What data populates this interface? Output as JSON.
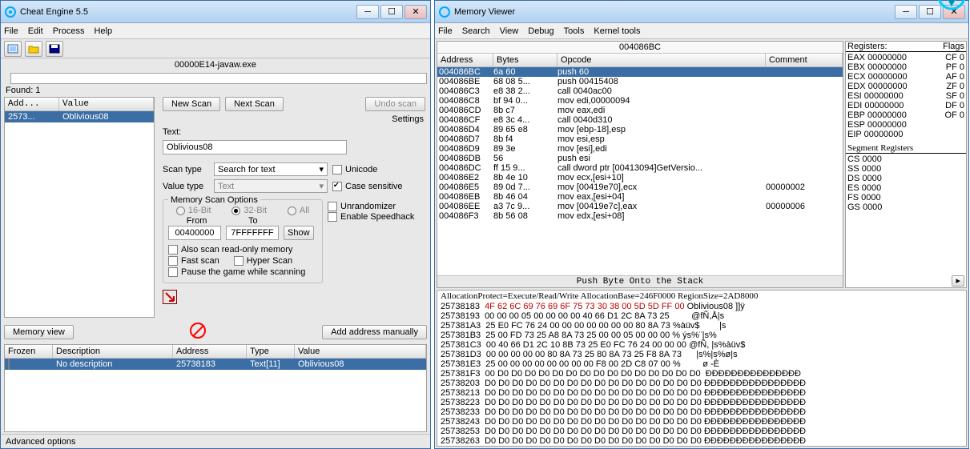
{
  "ce": {
    "title": "Cheat Engine 5.5",
    "menu": [
      "File",
      "Edit",
      "Process",
      "Help"
    ],
    "process": "00000E14-javaw.exe",
    "found": "Found: 1",
    "results_hdr": {
      "addr": "Add...",
      "val": "Value"
    },
    "results": {
      "addr": "2573...",
      "val": "Oblivious08"
    },
    "new_scan": "New Scan",
    "next_scan": "Next Scan",
    "undo_scan": "Undo scan",
    "settings": "Settings",
    "text_lbl": "Text:",
    "text_val": "Oblivious08",
    "scan_type_lbl": "Scan type",
    "scan_type_val": "Search for text",
    "value_type_lbl": "Value type",
    "value_type_val": "Text",
    "unicode": "Unicode",
    "case_sens": "Case sensitive",
    "mem_opts": "Memory Scan Options",
    "bit16": "16-Bit",
    "bit32": "32-Bit",
    "bitall": "All",
    "from": "From",
    "to": "To",
    "from_v": "00400000",
    "to_v": "7FFFFFFF",
    "show": "Show",
    "readonly": "Also scan read-only memory",
    "fastscan": "Fast scan",
    "hyperscan": "Hyper Scan",
    "pausegame": "Pause the game while scanning",
    "unrand": "Unrandomizer",
    "speedhack": "Enable Speedhack",
    "memview": "Memory view",
    "addman": "Add address manually",
    "tbl_hdr": {
      "fr": "Frozen",
      "de": "Description",
      "ad": "Address",
      "ty": "Type",
      "va": "Value"
    },
    "tbl_row": {
      "de": "No description",
      "ad": "25738183",
      "ty": "Text[11]",
      "va": "Oblivious08"
    },
    "adv": "Advanced options"
  },
  "mv": {
    "title": "Memory Viewer",
    "menu": [
      "File",
      "Search",
      "View",
      "Debug",
      "Tools",
      "Kernel tools"
    ],
    "curaddr": "004086BC",
    "cols": {
      "a": "Address",
      "b": "Bytes",
      "o": "Opcode",
      "c": "Comment"
    },
    "rows": [
      {
        "a": "004086BC",
        "b": "6a 60",
        "o": "push 60",
        "c": "",
        "sel": true
      },
      {
        "a": "004086BE",
        "b": "68 08 5...",
        "o": "push 00415408",
        "c": ""
      },
      {
        "a": "004086C3",
        "b": "e8 38 2...",
        "o": "call 0040ac00",
        "c": ""
      },
      {
        "a": "004086C8",
        "b": "bf 94 0...",
        "o": "mov edi,00000094",
        "c": ""
      },
      {
        "a": "004086CD",
        "b": "8b c7",
        "o": "mov eax,edi",
        "c": ""
      },
      {
        "a": "004086CF",
        "b": "e8 3c 4...",
        "o": "call 0040d310",
        "c": ""
      },
      {
        "a": "004086D4",
        "b": "89 65 e8",
        "o": "mov [ebp-18],esp",
        "c": ""
      },
      {
        "a": "004086D7",
        "b": "8b f4",
        "o": "mov esi,esp",
        "c": ""
      },
      {
        "a": "004086D9",
        "b": "89 3e",
        "o": "mov [esi],edi",
        "c": ""
      },
      {
        "a": "004086DB",
        "b": "56",
        "o": "push esi",
        "c": ""
      },
      {
        "a": "004086DC",
        "b": "ff 15 9...",
        "o": "call dword ptr [00413094]GetVersio...",
        "c": ""
      },
      {
        "a": "004086E2",
        "b": "8b 4e 10",
        "o": "mov ecx,[esi+10]",
        "c": ""
      },
      {
        "a": "004086E5",
        "b": "89 0d 7...",
        "o": "mov [00419e70],ecx",
        "c": "00000002"
      },
      {
        "a": "004086EB",
        "b": "8b 46 04",
        "o": "mov eax,[esi+04]",
        "c": ""
      },
      {
        "a": "004086EE",
        "b": "a3 7c 9...",
        "o": "mov [00419e7c],eax",
        "c": "00000006"
      },
      {
        "a": "004086F3",
        "b": "8b 56 08",
        "o": "mov edx,[esi+08]",
        "c": ""
      }
    ],
    "info": "Push Byte Onto the Stack",
    "regs_h": "Registers:",
    "flags_h": "Flags",
    "regs": [
      {
        "n": "EAX",
        "v": "00000000",
        "f": "CF 0"
      },
      {
        "n": "EBX",
        "v": "00000000",
        "f": "PF 0"
      },
      {
        "n": "ECX",
        "v": "00000000",
        "f": "AF 0"
      },
      {
        "n": "EDX",
        "v": "00000000",
        "f": "ZF 0"
      },
      {
        "n": "ESI",
        "v": "00000000",
        "f": "SF 0"
      },
      {
        "n": "EDI",
        "v": "00000000",
        "f": "DF 0"
      },
      {
        "n": "EBP",
        "v": "00000000",
        "f": "OF 0"
      },
      {
        "n": "ESP",
        "v": "00000000",
        "f": ""
      },
      {
        "n": "EIP",
        "v": "00000000",
        "f": ""
      }
    ],
    "seg_h": "Segment Registers",
    "segs": [
      "CS 0000",
      "SS 0000",
      "DS 0000",
      "ES 0000",
      "FS 0000",
      "GS 0000"
    ],
    "dump_hdr": "AllocationProtect=Execute/Read/Write AllocationBase=246F0000 RegionSize=2AD8000",
    "dump": [
      {
        "a": "25738183",
        "h": "4F 62 6C 69 76 69 6F 75 73 30 38 00 5D 5D FF 00",
        "t": "Oblivious08 ]]ÿ",
        "red": true
      },
      {
        "a": "25738193",
        "h": "00 00 00 05 00 00 00 00 40 66 D1 2C 8A 73 25",
        "t": "        @fÑ,Å|s"
      },
      {
        "a": "257381A3",
        "h": "25 E0 FC 76 24 00 00 00 00 00 00 00 80 8A 73",
        "t": "%àüv$        |s"
      },
      {
        "a": "257381B3",
        "h": "25 00 FD 73 25 A8 8A 73 25 00 00 05 00 00 00",
        "t": "% ýs%¨|s%"
      },
      {
        "a": "257381C3",
        "h": "00 40 66 D1 2C 10 8B 73 25 E0 FC 76 24 00 00",
        "t": "00 @fÑ, |s%àüv$"
      },
      {
        "a": "257381D3",
        "h": "00 00 00 00 00 80 8A 73 25 80 8A 73 25 F8 8A",
        "t": "73      |s%|s%ø|s"
      },
      {
        "a": "257381E3",
        "h": "25 00 00 00 00 00 00 00 00 F8 00 2D C8 07 00",
        "t": "%         ø -È"
      },
      {
        "a": "257381F3",
        "h": "00 D0 D0 D0 D0 D0 D0 D0 D0 D0 D0 D0 D0 D0 D0",
        "t": "D0  ÐÐÐÐÐÐÐÐÐÐÐÐÐÐÐ"
      },
      {
        "a": "25738203",
        "h": "D0 D0 D0 D0 D0 D0 D0 D0 D0 D0 D0 D0 D0 D0 D0",
        "t": "D0 ÐÐÐÐÐÐÐÐÐÐÐÐÐÐÐÐ"
      },
      {
        "a": "25738213",
        "h": "D0 D0 D0 D0 D0 D0 D0 D0 D0 D0 D0 D0 D0 D0 D0",
        "t": "D0 ÐÐÐÐÐÐÐÐÐÐÐÐÐÐÐÐ"
      },
      {
        "a": "25738223",
        "h": "D0 D0 D0 D0 D0 D0 D0 D0 D0 D0 D0 D0 D0 D0 D0",
        "t": "D0 ÐÐÐÐÐÐÐÐÐÐÐÐÐÐÐÐ"
      },
      {
        "a": "25738233",
        "h": "D0 D0 D0 D0 D0 D0 D0 D0 D0 D0 D0 D0 D0 D0 D0",
        "t": "D0 ÐÐÐÐÐÐÐÐÐÐÐÐÐÐÐÐ"
      },
      {
        "a": "25738243",
        "h": "D0 D0 D0 D0 D0 D0 D0 D0 D0 D0 D0 D0 D0 D0 D0",
        "t": "D0 ÐÐÐÐÐÐÐÐÐÐÐÐÐÐÐÐ"
      },
      {
        "a": "25738253",
        "h": "D0 D0 D0 D0 D0 D0 D0 D0 D0 D0 D0 D0 D0 D0 D0",
        "t": "D0 ÐÐÐÐÐÐÐÐÐÐÐÐÐÐÐÐ"
      },
      {
        "a": "25738263",
        "h": "D0 D0 D0 D0 D0 D0 D0 D0 D0 D0 D0 D0 D0 D0 D0",
        "t": "D0 ÐÐÐÐÐÐÐÐÐÐÐÐÐÐÐÐ"
      }
    ]
  }
}
